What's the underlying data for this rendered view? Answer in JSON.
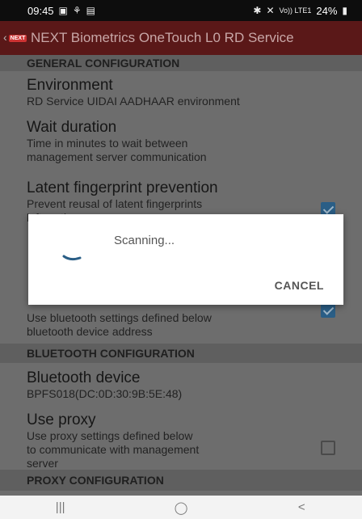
{
  "status_bar": {
    "time": "09:45",
    "network_text": "Vo)) LTE1",
    "battery": "24%"
  },
  "app": {
    "logo_text": "NEXT",
    "title": "NEXT Biometrics OneTouch L0 RD Service"
  },
  "sections": {
    "general": "GENERAL CONFIGURATION",
    "bluetooth": "BLUETOOTH CONFIGURATION",
    "proxy": "PROXY CONFIGURATION"
  },
  "preferences": {
    "environment": {
      "title": "Environment",
      "summary": "RD Service UIDAI AADHAAR environment"
    },
    "wait_duration": {
      "title": "Wait duration",
      "summary_1": "Time in minutes to wait between",
      "summary_2": "management server communication"
    },
    "latent": {
      "title": "Latent fingerprint prevention",
      "summary_1": "Prevent reusal of latent fingerprints",
      "summary_2": "left on the sensor",
      "checked": true
    },
    "use_bluetooth": {
      "summary_1": "Use bluetooth settings defined below",
      "summary_2": "bluetooth device address",
      "checked": true
    },
    "bluetooth_device": {
      "title": "Bluetooth device",
      "summary": "BPFS018(DC:0D:30:9B:5E:48)"
    },
    "use_proxy": {
      "title": "Use proxy",
      "summary_1": "Use proxy settings defined below",
      "summary_2": "to communicate with management",
      "summary_3": "server",
      "checked": false
    }
  },
  "dialog": {
    "message": "Scanning...",
    "cancel_label": "CANCEL"
  },
  "nav": {
    "recents": "|||",
    "home": "◯",
    "back": "<"
  },
  "colors": {
    "title_bar": "#5a1818",
    "dim_background": "#6d6d6d",
    "checkbox_checked": "#2a5e86"
  }
}
